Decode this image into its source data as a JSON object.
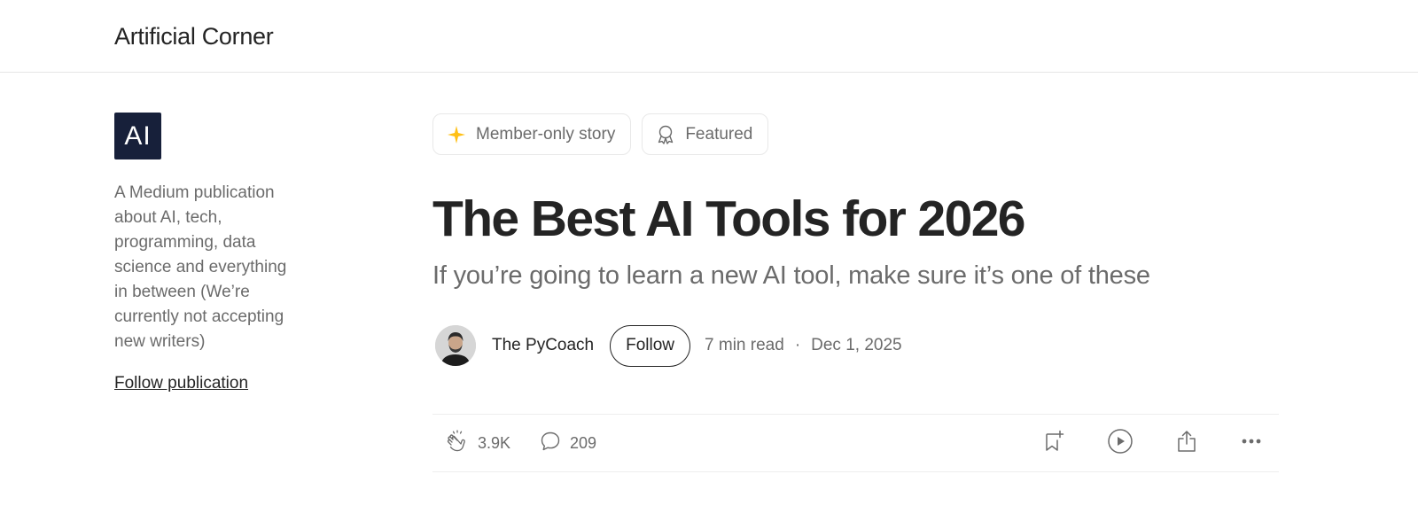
{
  "header": {
    "publication_name": "Artificial Corner"
  },
  "sidebar": {
    "logo_text": "AI",
    "description": "A Medium publication about AI, tech, programming, data science and everything in between (We’re currently not accepting new writers)",
    "follow_link": "Follow publication"
  },
  "article": {
    "badges": [
      {
        "label": "Member-only story",
        "icon": "star-icon",
        "icon_color": "#ffc017"
      },
      {
        "label": "Featured",
        "icon": "award-icon"
      }
    ],
    "title": "The Best AI Tools for 2026",
    "subtitle": "If you’re going to learn a new AI tool, make sure it’s one of these",
    "author": "The PyCoach",
    "follow_label": "Follow",
    "read_time": "7 min read",
    "separator": "·",
    "date": "Dec 1, 2025"
  },
  "actions": {
    "claps": "3.9K",
    "comments": "209",
    "icons": [
      "clap-icon",
      "comment-icon",
      "bookmark-add-icon",
      "play-icon",
      "share-icon",
      "more-icon"
    ]
  },
  "colors": {
    "logo_bg": "#17203a",
    "text_primary": "#242424",
    "text_secondary": "#6b6b6b",
    "star": "#ffc017"
  }
}
